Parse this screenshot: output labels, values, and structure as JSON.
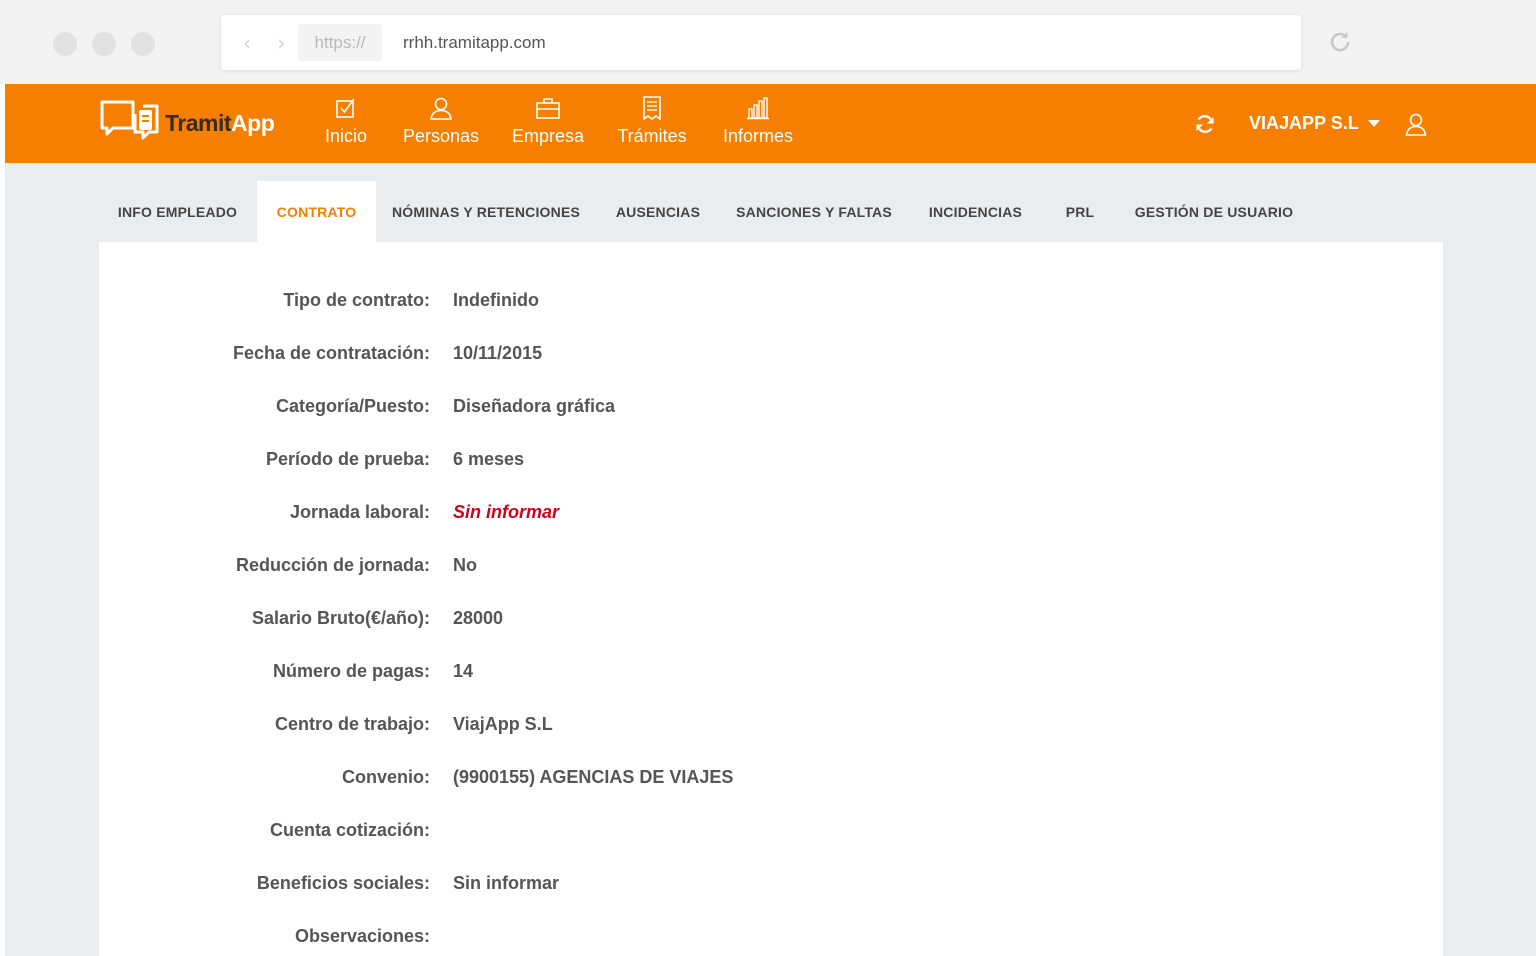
{
  "browser": {
    "protocol": "https://",
    "url": "rrhh.tramitapp.com"
  },
  "header": {
    "logo": {
      "part1": "Tramit",
      "part2": "App"
    },
    "nav": [
      {
        "label": "Inicio",
        "icon": "checkbox-icon"
      },
      {
        "label": "Personas",
        "icon": "user-icon"
      },
      {
        "label": "Empresa",
        "icon": "briefcase-icon"
      },
      {
        "label": "Trámites",
        "icon": "document-icon"
      },
      {
        "label": "Informes",
        "icon": "bar-chart-icon"
      }
    ],
    "company": "VIAJAPP S.L",
    "accent_color": "#f77f00"
  },
  "tabs": [
    {
      "label": "INFO EMPLEADO",
      "active": false
    },
    {
      "label": "CONTRATO",
      "active": true
    },
    {
      "label": "NÓMINAS Y RETENCIONES",
      "active": false
    },
    {
      "label": "AUSENCIAS",
      "active": false
    },
    {
      "label": "SANCIONES Y FALTAS",
      "active": false
    },
    {
      "label": "INCIDENCIAS",
      "active": false
    },
    {
      "label": "PRL",
      "active": false
    },
    {
      "label": "GESTIÓN DE USUARIO",
      "active": false
    }
  ],
  "contract": {
    "fields": [
      {
        "label": "Tipo de contrato:",
        "value": "Indefinido"
      },
      {
        "label": "Fecha de contratación:",
        "value": "10/11/2015"
      },
      {
        "label": "Categoría/Puesto:",
        "value": "Diseñadora gráfica"
      },
      {
        "label": "Período de prueba:",
        "value": "6 meses"
      },
      {
        "label": "Jornada laboral:",
        "value": "Sin informar"
      },
      {
        "label": "Reducción de jornada:",
        "value": "No"
      },
      {
        "label": "Salario Bruto(€/año):",
        "value": "28000"
      },
      {
        "label": "Número de pagas:",
        "value": "14"
      },
      {
        "label": "Centro de trabajo:",
        "value": "ViajApp S.L"
      },
      {
        "label": "Convenio:",
        "value": "(9900155) AGENCIAS DE VIAJES"
      },
      {
        "label": "Cuenta cotización:",
        "value": ""
      },
      {
        "label": "Beneficios sociales:",
        "value": "Sin informar"
      },
      {
        "label": "Observaciones:",
        "value": ""
      }
    ],
    "warning_color": "#d0021b"
  }
}
